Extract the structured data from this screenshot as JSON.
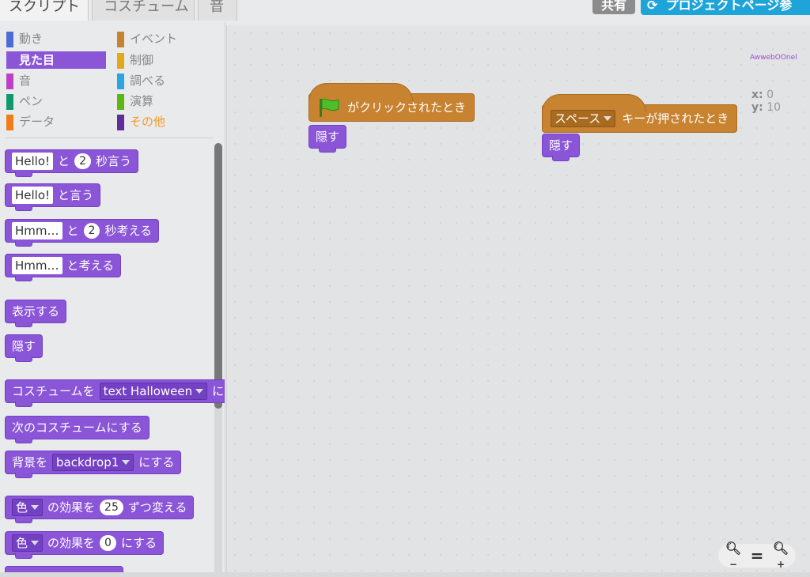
{
  "tabs": {
    "scripts": "スクリプト",
    "costumes": "コスチューム",
    "sounds": "音"
  },
  "header": {
    "share": "共有",
    "project_page": "プロジェクトページ参"
  },
  "categories": [
    {
      "label": "動き",
      "color": "#4a6cd4"
    },
    {
      "label": "イベント",
      "color": "#c88330"
    },
    {
      "label": "見た目",
      "color": "#8a55d7",
      "selected": true
    },
    {
      "label": "制御",
      "color": "#e1a91a"
    },
    {
      "label": "音",
      "color": "#bb42c3"
    },
    {
      "label": "調べる",
      "color": "#2ca5e2"
    },
    {
      "label": "ペン",
      "color": "#0e9a6c"
    },
    {
      "label": "演算",
      "color": "#5cb712"
    },
    {
      "label": "データ",
      "color": "#ee7d16"
    },
    {
      "label": "その他",
      "color": "#632d99"
    }
  ],
  "palette_blocks": {
    "say_secs": {
      "text": "Hello!",
      "mid": "と",
      "num": "2",
      "end": "秒言う"
    },
    "say": {
      "text": "Hello!",
      "end": "と言う"
    },
    "think_secs": {
      "text": "Hmm…",
      "mid": "と",
      "num": "2",
      "end": "秒考える"
    },
    "think": {
      "text": "Hmm…",
      "end": "と考える"
    },
    "show": "表示する",
    "hide": "隠す",
    "switch_costume": {
      "start": "コスチュームを",
      "value": "text Halloween",
      "end": "に"
    },
    "next_costume": "次のコスチュームにする",
    "switch_backdrop": {
      "start": "背景を",
      "value": "backdrop1",
      "end": "にする"
    },
    "change_effect": {
      "effect": "色",
      "mid": "の効果を",
      "num": "25",
      "end": "ずつ変える"
    },
    "set_effect": {
      "effect": "色",
      "mid": "の効果を",
      "num": "0",
      "end": "にする"
    }
  },
  "scripts": {
    "flag_hat": "がクリックされたとき",
    "hide1": "隠す",
    "key_hat": {
      "key": "スペース",
      "end": "キーが押されたとき"
    },
    "hide2": "隠す"
  },
  "sprite": {
    "name": "AwwebOOnel",
    "x_label": "x:",
    "x": "0",
    "y_label": "y:",
    "y": "10"
  },
  "zoom": {
    "out": "−",
    "reset": "=",
    "in": "+"
  }
}
